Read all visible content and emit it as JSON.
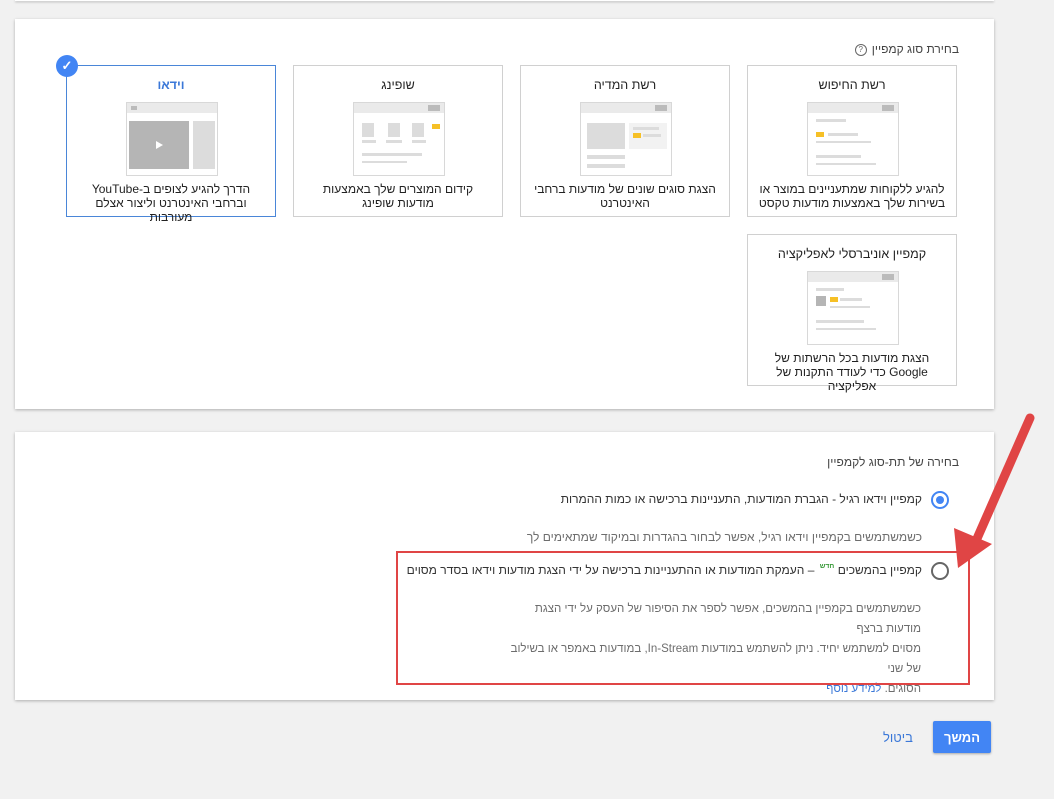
{
  "campaign_type": {
    "title": "בחירת סוג קמפיין",
    "help_icon": "?",
    "cards": [
      {
        "title": "רשת החיפוש",
        "description": "להגיע ללקוחות שמתעניינים במוצר או בשירות שלך באמצעות מודעות טקסט",
        "icon": "search-network-thumbnail",
        "selected": false
      },
      {
        "title": "רשת המדיה",
        "description": "הצגת סוגים שונים של מודעות ברחבי האינטרנט",
        "icon": "display-network-thumbnail",
        "selected": false
      },
      {
        "title": "שופינג",
        "description": "קידום המוצרים שלך באמצעות מודעות שופינג",
        "icon": "shopping-thumbnail",
        "selected": false
      },
      {
        "title": "וידאו",
        "description": "הדרך להגיע לצופים ב-YouTube וברחבי האינטרנט וליצור אצלם מעורבות",
        "icon": "video-thumbnail",
        "selected": true
      },
      {
        "title": "קמפיין אוניברסלי לאפליקציה",
        "description": "הצגת מודעות בכל הרשתות של Google כדי לעודד התקנות של אפליקציה",
        "icon": "app-thumbnail",
        "selected": false
      }
    ],
    "selected_check": "✓"
  },
  "subtype": {
    "title": "בחירה של תת-סוג לקמפיין",
    "options": [
      {
        "label": "קמפיין וידאו רגיל - הגברת המודעות, התעניינות ברכישה או כמות ההמרות",
        "checked": true
      },
      {
        "label_pre": "קמפיין בהמשכים",
        "badge": "חדש",
        "label_post": "– העמקת המודעות או ההתעניינות ברכישה על ידי הצגת מודעות וידאו בסדר מסוים",
        "checked": false
      }
    ],
    "regular_hint": "כשמשתמשים בקמפיין וידאו רגיל, אפשר לבחור בהגדרות ובמיקוד שמתאימים לך",
    "sequence_desc_1": "כשמשתמשים בקמפיין בהמשכים, אפשר לספר את הסיפור של העסק על ידי הצגת מודעות ברצף",
    "sequence_desc_2": "מסוים למשתמש יחיד. ניתן להשתמש במודעות In-Stream, במודעות באמפר או בשילוב של שני",
    "sequence_desc_3": "הסוגים.",
    "learn_more": "למידע נוסף"
  },
  "actions": {
    "continue": "המשך",
    "cancel": "ביטול"
  },
  "colors": {
    "accent": "#4285f4",
    "highlight": "#e04545",
    "new_badge": "#3b9b3b"
  }
}
